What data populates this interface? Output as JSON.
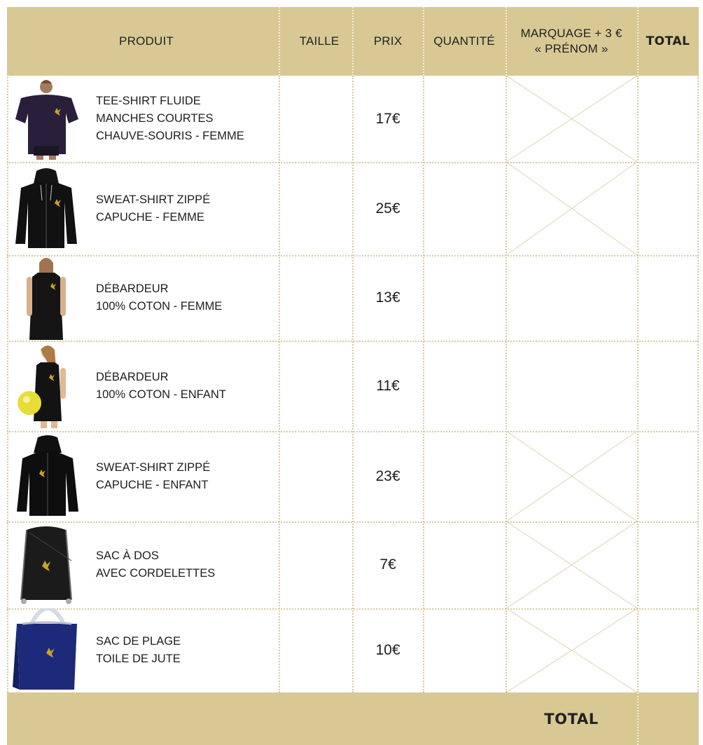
{
  "header": {
    "produit": "PRODUIT",
    "taille": "TAILLE",
    "prix": "PRIX",
    "quantite": "QUANTITÉ",
    "marquage_line1": "MARQUAGE + 3 €",
    "marquage_line2": "« PRÉNOM »",
    "total": "TOTAL"
  },
  "products": [
    {
      "name_lines": [
        "TEE-SHIRT FLUIDE",
        "MANCHES COURTES",
        "CHAUVE-SOURIS - FEMME"
      ],
      "price": "17€",
      "icon": "tee-shirt-woman-image",
      "marking_unavailable": true
    },
    {
      "name_lines": [
        "SWEAT-SHIRT ZIPPÉ",
        "CAPUCHE - FEMME"
      ],
      "price": "25€",
      "icon": "zip-hoodie-image",
      "marking_unavailable": true
    },
    {
      "name_lines": [
        "DÉBARDEUR",
        "100% COTON - FEMME"
      ],
      "price": "13€",
      "icon": "tank-top-woman-image",
      "marking_unavailable": false
    },
    {
      "name_lines": [
        "DÉBARDEUR",
        "100% COTON - ENFANT"
      ],
      "price": "11€",
      "icon": "tank-top-child-image",
      "marking_unavailable": false
    },
    {
      "name_lines": [
        "SWEAT-SHIRT ZIPPÉ",
        "CAPUCHE - ENFANT"
      ],
      "price": "23€",
      "icon": "child-hoodie-image",
      "marking_unavailable": true
    },
    {
      "name_lines": [
        "SAC À DOS",
        "AVEC CORDELETTES"
      ],
      "price": "7€",
      "icon": "drawstring-bag-image",
      "marking_unavailable": true
    },
    {
      "name_lines": [
        "SAC DE PLAGE",
        "TOILE DE JUTE"
      ],
      "price": "10€",
      "icon": "jute-beach-bag-image",
      "marking_unavailable": true
    }
  ],
  "footer": {
    "total": "TOTAL"
  },
  "colors": {
    "header_bg": "#d8c994",
    "grid": "#d6c9a0",
    "text": "#1e1e1e",
    "logo_gold": "#c9a227"
  }
}
